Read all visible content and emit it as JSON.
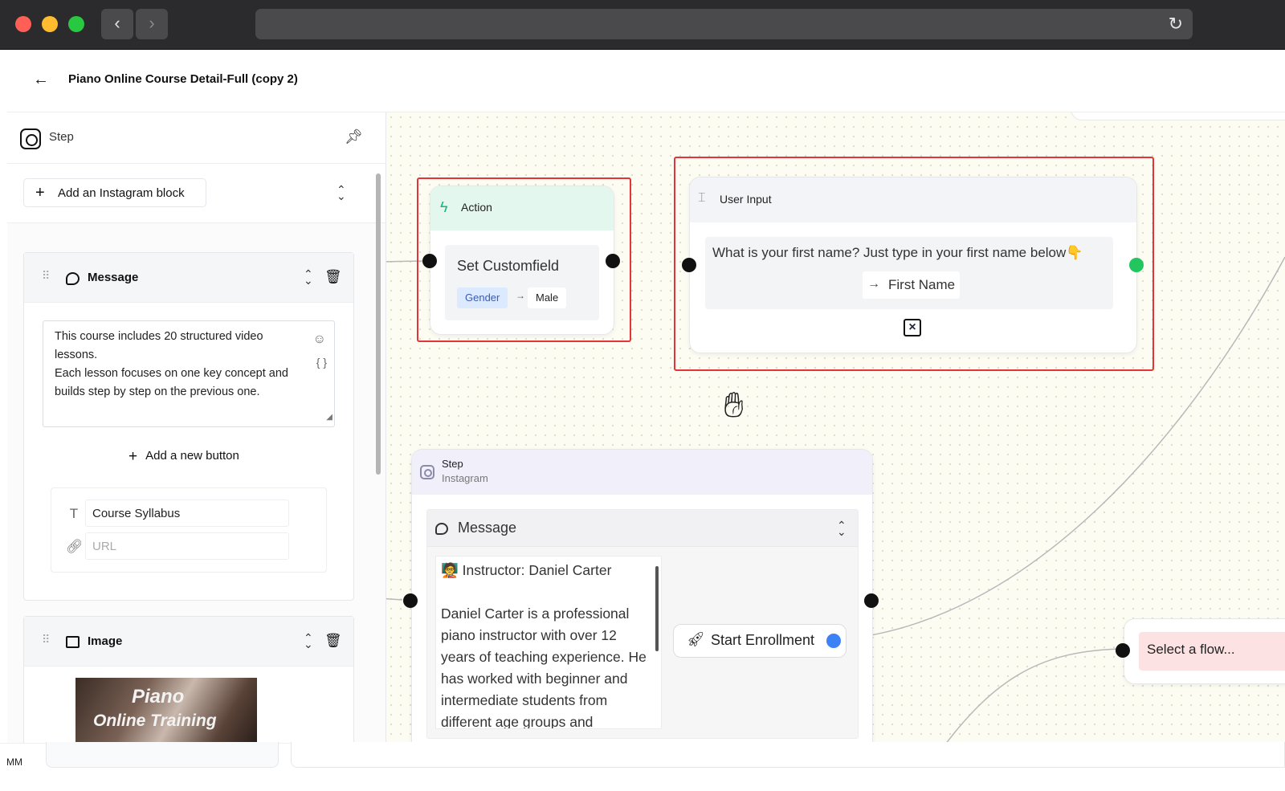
{
  "app": {
    "title": "Piano Online Course Detail-Full (copy 2)"
  },
  "browser": {
    "back_glyph": "‹",
    "forward_glyph": "›",
    "reload_glyph": "↻"
  },
  "panel": {
    "header_label": "Step",
    "add_block_label": "Add an Instagram block",
    "message_block": {
      "title": "Message",
      "text": "This course includes 20 structured video lessons.\nEach lesson focuses on one key concept and builds step by step on the previous one.",
      "add_button_label": "Add a new button",
      "button_title_value": "Course Syllabus",
      "button_url_placeholder": "URL"
    },
    "image_block": {
      "title": "Image",
      "thumbnail_line1": "Piano",
      "thumbnail_line2": "Online Training"
    }
  },
  "canvas": {
    "action_node": {
      "header": "Action",
      "title": "Set Customfield",
      "field": "Gender",
      "arrow": "→",
      "value": "Male"
    },
    "user_input_node": {
      "header": "User Input",
      "question": "What is your first name? Just type in your first name below👇",
      "save_to": "First Name"
    },
    "step_node": {
      "title": "Step",
      "subtitle": "Instagram",
      "message_label": "Message",
      "message_text": "🧑‍🏫 Instructor: Daniel Carter\n\nDaniel Carter is a professional piano instructor with over 12 years of teaching experience. He has worked with beginner and intermediate students from different age groups and",
      "button_label": "Start Enrollment"
    },
    "flow_node": {
      "label": "Select a flow..."
    }
  },
  "footer": {
    "user_initials": "MM"
  },
  "colors": {
    "selection_outline": "#e3343a",
    "port_default": "#111111",
    "port_success": "#22c55e",
    "port_button": "#3b82f6",
    "action_header_bg": "#e4f7ee",
    "canvas_bg": "#fdfcf3"
  },
  "icons": {
    "back": "arrow-left-icon",
    "pin": "pin-icon",
    "instagram": "instagram-icon",
    "message": "chat-bubble-icon",
    "image": "image-icon",
    "trash": "trash-icon",
    "drag": "drag-handle-icon",
    "bolt": "lightning-icon",
    "rocket": "rocket-icon",
    "hand_cursor": "grab-hand-icon"
  }
}
